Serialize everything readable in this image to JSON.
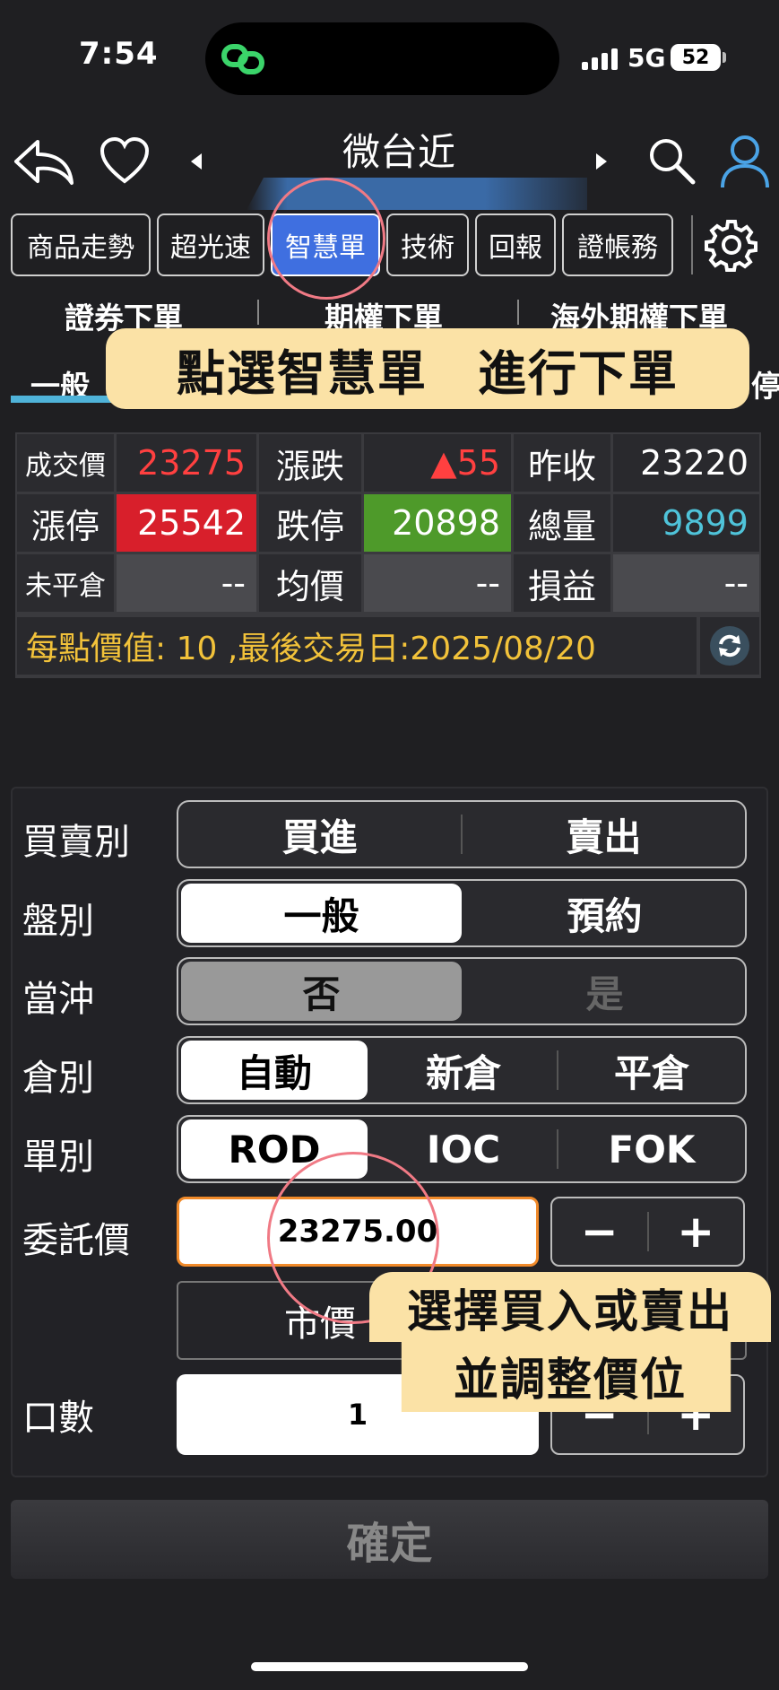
{
  "status": {
    "time": "7:54",
    "network": "5G",
    "battery": "52"
  },
  "header": {
    "title": "微台近"
  },
  "tabs": [
    "商品走勢",
    "超光速",
    "智慧單",
    "技術",
    "回報",
    "證帳務"
  ],
  "subnav": {
    "items": [
      "證券下單",
      "期權下單",
      "海外期權下單"
    ]
  },
  "subtabs": {
    "active": "一般",
    "partial_right": "停"
  },
  "annotations": {
    "banner_top": "點選智慧單　進行下單",
    "banner_bottom_line1": "選擇買入或賣出",
    "banner_bottom_line2": "並調整價位"
  },
  "quote": {
    "row1": {
      "l1": "成交價",
      "v1": "23275",
      "l2": "漲跌",
      "v2": "▲55",
      "l3": "昨收",
      "v3": "23220"
    },
    "row2": {
      "l1": "漲停",
      "v1": "25542",
      "l2": "跌停",
      "v2": "20898",
      "l3": "總量",
      "v3": "9899"
    },
    "row3": {
      "l1": "未平倉",
      "v1": "--",
      "l2": "均價",
      "v2": "--",
      "l3": "損益",
      "v3": "--"
    },
    "info": "每點價值: 10 ,最後交易日:2025/08/20",
    "colors": {
      "up": "#ff4040",
      "limit_up_bg": "#d81f2b",
      "limit_down_bg": "#4e9a2a",
      "volume": "#4fc3d9",
      "info": "#f2c23a"
    }
  },
  "form": {
    "side": {
      "label": "買賣別",
      "options": [
        "買進",
        "賣出"
      ]
    },
    "session": {
      "label": "盤別",
      "options": [
        "一般",
        "預約"
      ],
      "selected": "一般"
    },
    "daytrade": {
      "label": "當沖",
      "options": [
        "否",
        "是"
      ],
      "selected": "否"
    },
    "position": {
      "label": "倉別",
      "options": [
        "自動",
        "新倉",
        "平倉"
      ],
      "selected": "自動"
    },
    "order_type": {
      "label": "單別",
      "options": [
        "ROD",
        "IOC",
        "FOK"
      ],
      "selected": "ROD"
    },
    "price": {
      "label": "委託價",
      "value": "23275.00",
      "minus": "−",
      "plus": "+"
    },
    "market_price": "市價",
    "quantity": {
      "label": "口數",
      "value": "1"
    }
  },
  "confirm_label": "確定"
}
